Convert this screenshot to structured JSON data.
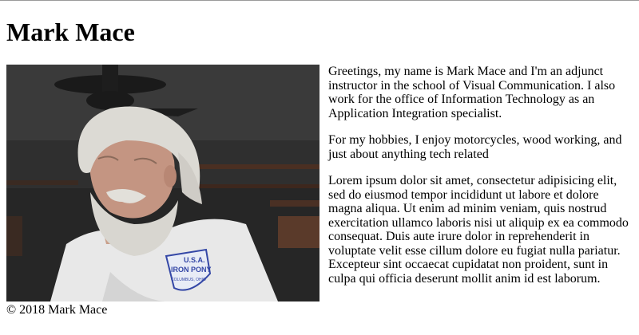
{
  "page": {
    "title": "Mark Mace"
  },
  "photo": {
    "shirt_logo_line1": "U.S.A.",
    "shirt_logo_line2": "IRON PONY",
    "shirt_logo_line3": "COLUMBUS, OHIO"
  },
  "content": {
    "paragraphs": [
      "Greetings, my name is Mark Mace and I'm an adjunct instructor in the school of Visual Communication. I also work for the office of Information Technology as an Application Integration specialist.",
      "For my hobbies, I enjoy motorcycles, wood working, and just about anything tech related",
      "Lorem ipsum dolor sit amet, consectetur adipisicing elit, sed do eiusmod tempor incididunt ut labore et dolore magna aliqua. Ut enim ad minim veniam, quis nostrud exercitation ullamco laboris nisi ut aliquip ex ea commodo consequat. Duis aute irure dolor in reprehenderit in voluptate velit esse cillum dolore eu fugiat nulla pariatur. Excepteur sint occaecat cupidatat non proident, sunt in culpa qui officia deserunt mollit anim id est laborum."
    ]
  },
  "footer": {
    "copyright": "© 2018 Mark Mace"
  }
}
